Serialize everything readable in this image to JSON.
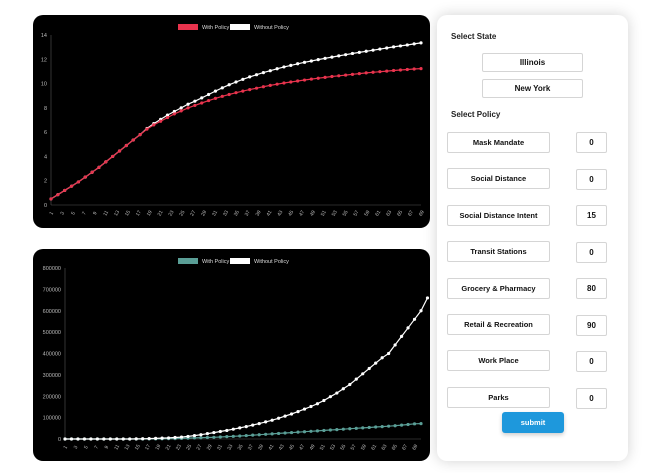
{
  "chart_data": [
    {
      "type": "line",
      "legend_position": "top-center",
      "x_ticks": [
        "1",
        "3",
        "5",
        "7",
        "9",
        "11",
        "13",
        "15",
        "17",
        "19",
        "21",
        "23",
        "25",
        "27",
        "29",
        "31",
        "33",
        "35",
        "37",
        "39",
        "41",
        "43",
        "45",
        "47",
        "49",
        "51",
        "53",
        "55",
        "57",
        "59",
        "61",
        "63",
        "65",
        "67",
        "69"
      ],
      "y_ticks": [
        "0",
        "2",
        "4",
        "6",
        "8",
        "10",
        "12",
        "14"
      ],
      "ylim": [
        0,
        14
      ],
      "grid": false,
      "series": [
        {
          "name": "With Policy",
          "color": "#e8334d",
          "values": [
            0.5,
            0.85,
            1.2,
            1.55,
            1.9,
            2.3,
            2.7,
            3.1,
            3.55,
            4.0,
            4.45,
            4.9,
            5.35,
            5.8,
            6.25,
            6.6,
            6.9,
            7.2,
            7.5,
            7.75,
            8.0,
            8.2,
            8.4,
            8.6,
            8.78,
            8.95,
            9.1,
            9.25,
            9.38,
            9.5,
            9.62,
            9.74,
            9.85,
            9.95,
            10.05,
            10.13,
            10.21,
            10.29,
            10.37,
            10.44,
            10.51,
            10.58,
            10.64,
            10.7,
            10.76,
            10.82,
            10.88,
            10.93,
            10.98,
            11.03,
            11.08,
            11.12,
            11.16,
            11.2,
            11.23
          ]
        },
        {
          "name": "Without Policy",
          "color": "#ffffff",
          "values": [
            0.5,
            0.85,
            1.2,
            1.55,
            1.9,
            2.3,
            2.7,
            3.1,
            3.55,
            4.0,
            4.45,
            4.9,
            5.35,
            5.8,
            6.3,
            6.7,
            7.05,
            7.4,
            7.7,
            8.0,
            8.3,
            8.55,
            8.82,
            9.1,
            9.38,
            9.65,
            9.9,
            10.13,
            10.35,
            10.55,
            10.73,
            10.9,
            11.06,
            11.22,
            11.37,
            11.5,
            11.63,
            11.75,
            11.86,
            11.97,
            12.08,
            12.18,
            12.28,
            12.38,
            12.48,
            12.57,
            12.66,
            12.75,
            12.84,
            12.93,
            13.02,
            13.1,
            13.18,
            13.27,
            13.35
          ]
        }
      ]
    },
    {
      "type": "line",
      "legend_position": "top-center",
      "x_ticks": [
        "1",
        "3",
        "5",
        "7",
        "9",
        "11",
        "13",
        "15",
        "17",
        "19",
        "21",
        "23",
        "25",
        "27",
        "29",
        "31",
        "33",
        "35",
        "37",
        "39",
        "41",
        "43",
        "45",
        "47",
        "49",
        "51",
        "53",
        "55",
        "57",
        "59",
        "61",
        "63",
        "65",
        "67",
        "69"
      ],
      "y_ticks": [
        "0",
        "100000",
        "200000",
        "300000",
        "400000",
        "500000",
        "600000",
        "700000",
        "800000"
      ],
      "ylim": [
        0,
        800000
      ],
      "grid": false,
      "series": [
        {
          "name": "With Policy",
          "color": "#5a9e96",
          "values": [
            0,
            0,
            0,
            0,
            0,
            0,
            0,
            0,
            0,
            0,
            0,
            100,
            200,
            400,
            700,
            1000,
            1500,
            2000,
            3000,
            4000,
            5000,
            6000,
            7000,
            8000,
            9500,
            11000,
            12500,
            14000,
            16000,
            18000,
            20000,
            22000,
            24000,
            26000,
            28000,
            30000,
            32000,
            34000,
            36000,
            38000,
            40000,
            42000,
            44000,
            46000,
            48000,
            50000,
            52000,
            54000,
            56000,
            58000,
            60000,
            62000,
            65000,
            68000,
            71000,
            72000
          ]
        },
        {
          "name": "Without Policy",
          "color": "#ffffff",
          "values": [
            0,
            0,
            0,
            0,
            0,
            0,
            0,
            0,
            0,
            0,
            0,
            500,
            1000,
            2000,
            3000,
            4000,
            5000,
            7000,
            9000,
            12000,
            16000,
            20000,
            25000,
            30000,
            35000,
            40000,
            46000,
            52000,
            58000,
            65000,
            72000,
            80000,
            88000,
            97000,
            107000,
            117000,
            128000,
            140000,
            152000,
            165000,
            180000,
            198000,
            215000,
            235000,
            255000,
            280000,
            305000,
            330000,
            355000,
            380000,
            400000,
            440000,
            480000,
            520000,
            560000,
            600000,
            660000
          ]
        }
      ]
    }
  ],
  "panel": {
    "state_heading": "Select State",
    "states": [
      {
        "label": "Illinois",
        "selected": true
      },
      {
        "label": "New York",
        "selected": false
      }
    ],
    "policy_heading": "Select Policy",
    "policies": [
      {
        "label": "Mask Mandate",
        "value": "0",
        "highlighted": false
      },
      {
        "label": "Social Distance",
        "value": "0",
        "highlighted": false
      },
      {
        "label": "Social Distance Intent",
        "value": "15",
        "highlighted": true
      },
      {
        "label": "Transit Stations",
        "value": "0",
        "highlighted": false
      },
      {
        "label": "Grocery & Pharmacy",
        "value": "80",
        "highlighted": true
      },
      {
        "label": "Retail & Recreation",
        "value": "90",
        "highlighted": true
      },
      {
        "label": "Work Place",
        "value": "0",
        "highlighted": false
      },
      {
        "label": "Parks",
        "value": "0",
        "highlighted": false
      }
    ],
    "submit_label": "submit"
  }
}
